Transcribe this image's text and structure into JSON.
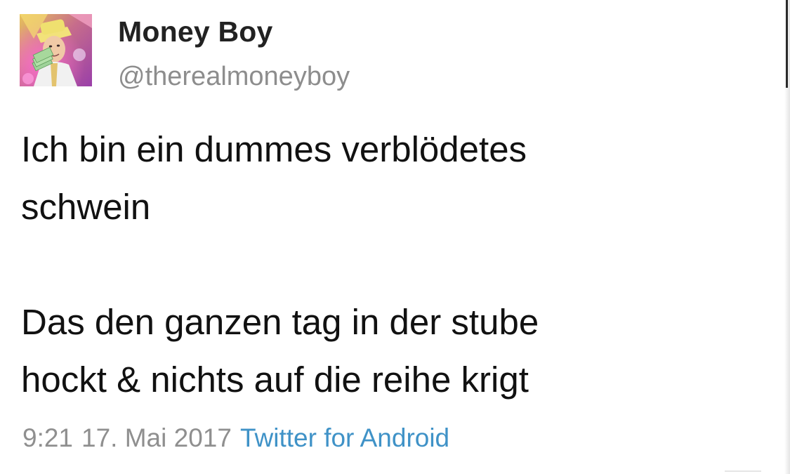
{
  "tweet": {
    "author": {
      "display_name": "Money Boy",
      "handle": "@therealmoneyboy",
      "avatar": "profile-avatar"
    },
    "paragraphs": [
      "Ich bin ein dummes verblödetes\nschwein",
      "Das den ganzen tag in der stube\nhockt & nichts auf die reihe krigt"
    ],
    "time": "9:21",
    "date": "17. Mai 2017",
    "source": "Twitter for Android"
  },
  "colors": {
    "name": "#222222",
    "muted": "#8f8f8f",
    "link": "#3f92c7",
    "text": "#111111"
  }
}
